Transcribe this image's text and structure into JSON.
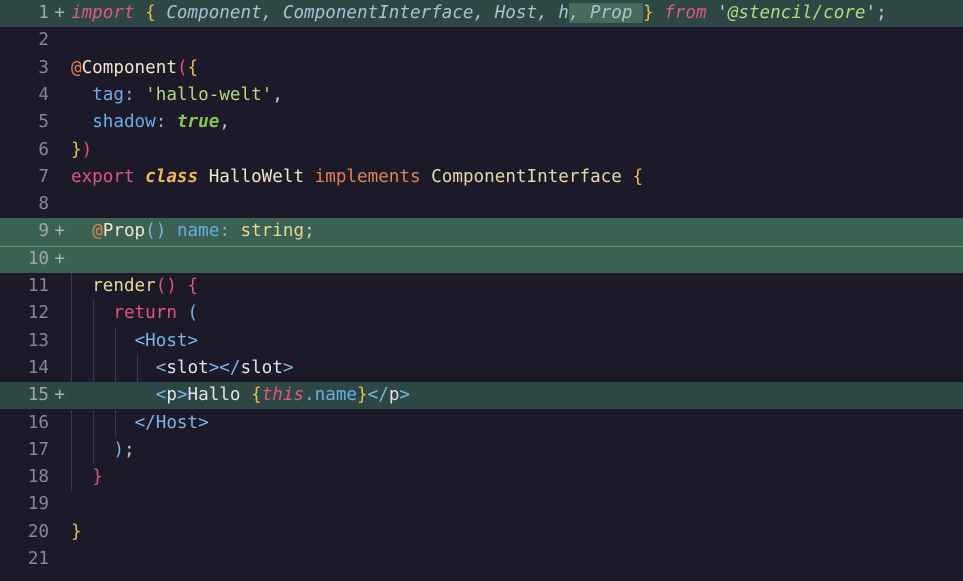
{
  "editor": {
    "lines": [
      {
        "num": "1",
        "mark": "+",
        "tokens": [
          {
            "t": "import",
            "c": "kw-i"
          },
          {
            "t": " ",
            "c": "plain"
          },
          {
            "t": "{",
            "c": "brk"
          },
          {
            "t": " Component, ComponentInterface, Host, h",
            "c": "id-i"
          },
          {
            "t": ", Prop ",
            "c": "id-i sel"
          },
          {
            "t": "}",
            "c": "brk"
          },
          {
            "t": " ",
            "c": "plain"
          },
          {
            "t": "from",
            "c": "kw-i"
          },
          {
            "t": " '",
            "c": "plain"
          },
          {
            "t": "@stencil/core",
            "c": "str-i"
          },
          {
            "t": "'",
            "c": "str"
          },
          {
            "t": ";",
            "c": "plain"
          }
        ]
      },
      {
        "num": "2",
        "tokens": []
      },
      {
        "num": "3",
        "tokens": [
          {
            "t": "@",
            "c": "dec"
          },
          {
            "t": "Component",
            "c": "cls"
          },
          {
            "t": "(",
            "c": "par"
          },
          {
            "t": "{",
            "c": "brk"
          }
        ]
      },
      {
        "num": "4",
        "tokens": [
          {
            "t": "  ",
            "c": "plain"
          },
          {
            "t": "tag",
            "c": "prop"
          },
          {
            "t": ": ",
            "c": "punct"
          },
          {
            "t": "'hallo-welt'",
            "c": "str"
          },
          {
            "t": ",",
            "c": "plain"
          }
        ]
      },
      {
        "num": "5",
        "tokens": [
          {
            "t": "  ",
            "c": "plain"
          },
          {
            "t": "shadow",
            "c": "prop"
          },
          {
            "t": ": ",
            "c": "punct"
          },
          {
            "t": "true",
            "c": "bool-i"
          },
          {
            "t": ",",
            "c": "plain"
          }
        ]
      },
      {
        "num": "6",
        "tokens": [
          {
            "t": "}",
            "c": "brk"
          },
          {
            "t": ")",
            "c": "par"
          }
        ]
      },
      {
        "num": "7",
        "tokens": [
          {
            "t": "export",
            "c": "kw"
          },
          {
            "t": " ",
            "c": "plain"
          },
          {
            "t": "class",
            "c": "cls-i"
          },
          {
            "t": " HalloWelt ",
            "c": "cls"
          },
          {
            "t": "implements",
            "c": "impl"
          },
          {
            "t": " ComponentInterface ",
            "c": "iface"
          },
          {
            "t": "{",
            "c": "brk"
          }
        ]
      },
      {
        "num": "8",
        "tokens": []
      },
      {
        "num": "9",
        "mark": "+",
        "tokens": [
          {
            "t": "  ",
            "c": "plain"
          },
          {
            "t": "@",
            "c": "dec"
          },
          {
            "t": "Prop",
            "c": "cls"
          },
          {
            "t": "()",
            "c": "par2"
          },
          {
            "t": " ",
            "c": "plain"
          },
          {
            "t": "name",
            "c": "prop"
          },
          {
            "t": ": ",
            "c": "punct"
          },
          {
            "t": "string",
            "c": "typ"
          },
          {
            "t": ";",
            "c": "plain"
          }
        ]
      },
      {
        "num": "10",
        "mark": "+",
        "tokens": []
      },
      {
        "num": "11",
        "tokens": [
          {
            "t": "  ",
            "c": "plain"
          },
          {
            "t": "render",
            "c": "fn"
          },
          {
            "t": "()",
            "c": "par"
          },
          {
            "t": " ",
            "c": "plain"
          },
          {
            "t": "{",
            "c": "par"
          }
        ]
      },
      {
        "num": "12",
        "tokens": [
          {
            "t": "    ",
            "c": "plain"
          },
          {
            "t": "return",
            "c": "kw"
          },
          {
            "t": " ",
            "c": "plain"
          },
          {
            "t": "(",
            "c": "par2"
          }
        ]
      },
      {
        "num": "13",
        "tokens": [
          {
            "t": "      ",
            "c": "plain"
          },
          {
            "t": "<",
            "c": "tag"
          },
          {
            "t": "Host",
            "c": "tag"
          },
          {
            "t": ">",
            "c": "tag"
          }
        ]
      },
      {
        "num": "14",
        "tokens": [
          {
            "t": "        ",
            "c": "plain"
          },
          {
            "t": "<",
            "c": "tag"
          },
          {
            "t": "slot",
            "c": "tagname"
          },
          {
            "t": "></",
            "c": "tag"
          },
          {
            "t": "slot",
            "c": "tagname"
          },
          {
            "t": ">",
            "c": "tag"
          }
        ]
      },
      {
        "num": "15",
        "mark": "+",
        "tokens": [
          {
            "t": "        ",
            "c": "plain"
          },
          {
            "t": "<",
            "c": "tag"
          },
          {
            "t": "p",
            "c": "tagname"
          },
          {
            "t": ">",
            "c": "tag"
          },
          {
            "t": "Hallo ",
            "c": "tagname"
          },
          {
            "t": "{",
            "c": "brk"
          },
          {
            "t": "this",
            "c": "this-i"
          },
          {
            "t": ".",
            "c": "punct"
          },
          {
            "t": "name",
            "c": "prop"
          },
          {
            "t": "}",
            "c": "brk"
          },
          {
            "t": "</",
            "c": "tag"
          },
          {
            "t": "p",
            "c": "tagname"
          },
          {
            "t": ">",
            "c": "tag"
          }
        ]
      },
      {
        "num": "16",
        "tokens": [
          {
            "t": "      ",
            "c": "plain"
          },
          {
            "t": "</",
            "c": "tag"
          },
          {
            "t": "Host",
            "c": "tag"
          },
          {
            "t": ">",
            "c": "tag"
          }
        ]
      },
      {
        "num": "17",
        "tokens": [
          {
            "t": "    ",
            "c": "plain"
          },
          {
            "t": ")",
            "c": "par2"
          },
          {
            "t": ";",
            "c": "plain"
          }
        ]
      },
      {
        "num": "18",
        "tokens": [
          {
            "t": "  ",
            "c": "plain"
          },
          {
            "t": "}",
            "c": "par"
          }
        ]
      },
      {
        "num": "19",
        "tokens": []
      },
      {
        "num": "20",
        "tokens": [
          {
            "t": "}",
            "c": "brk"
          }
        ]
      },
      {
        "num": "21",
        "tokens": []
      }
    ]
  }
}
